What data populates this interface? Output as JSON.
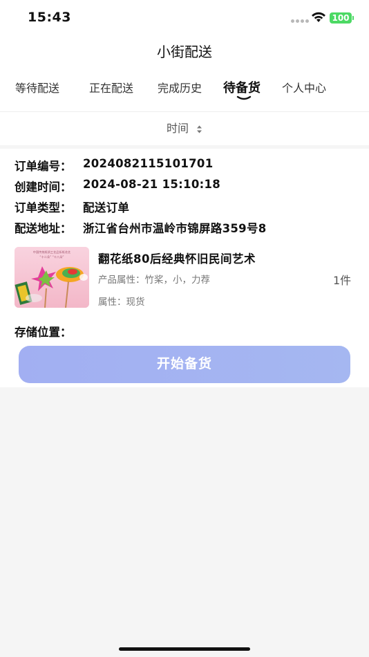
{
  "status_bar": {
    "time": "15:43",
    "battery": "100"
  },
  "header": {
    "title": "小街配送"
  },
  "tabs": [
    {
      "label": "等待配送"
    },
    {
      "label": "正在配送"
    },
    {
      "label": "完成历史"
    },
    {
      "label": "待备货",
      "active": true
    },
    {
      "label": "个人中心"
    }
  ],
  "sort": {
    "label": "时间"
  },
  "order": {
    "fields": [
      {
        "key": "订单编号：",
        "value": "2024082115101701"
      },
      {
        "key": "创建时间：",
        "value": "2024-08-21 15:10:18"
      },
      {
        "key": "订单类型：",
        "value": "配送订单"
      },
      {
        "key": "配送地址：",
        "value": "浙江省台州市温岭市锦屏路359号8"
      }
    ],
    "product": {
      "name": "翻花纸80后经典怀旧民间艺术",
      "attributes": "产品属性：竹桨，小，力荐",
      "quantity": "1件",
      "stock": "属性：现货",
      "thumb_caption_1": "中国传统纸质工艺品折纸花艺",
      "thumb_caption_2": "“十二朵”  “十八朵”"
    },
    "storage_label": "存储位置：",
    "start_button": "开始备货"
  },
  "colors": {
    "button_gradient_start": "#a2aff2",
    "button_gradient_end": "#a5b7f1",
    "battery": "#4cd964",
    "background": "#f5f5f5"
  },
  "icons": {
    "wifi": "wifi-icon",
    "sort": "sort-arrows-icon",
    "signal": "cellular-dots-icon"
  }
}
